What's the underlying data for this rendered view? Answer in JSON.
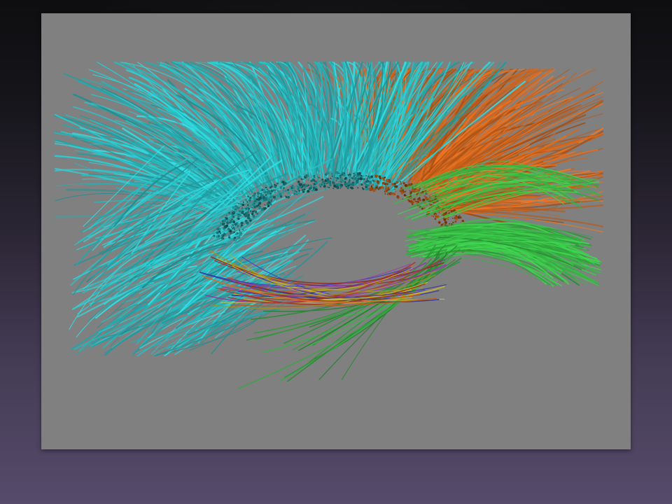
{
  "slide": {
    "background_colors": [
      "#0e0e10",
      "#2a2533",
      "#564b6a"
    ]
  },
  "figure": {
    "panel_color": "#808080",
    "bundle_colors": {
      "anterior": "#29c3c8",
      "posterior": "#d8681c",
      "lateral": "#3bc84a",
      "minor_red": "#a8342a",
      "minor_yellow": "#c8b42a",
      "minor_blue": "#3a3ab8",
      "minor_purple": "#8a3aa0"
    }
  }
}
